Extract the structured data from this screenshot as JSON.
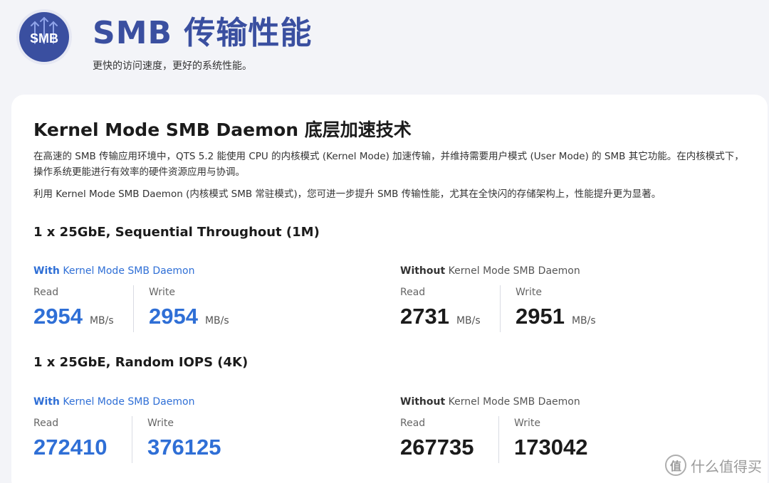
{
  "header": {
    "logo_text": "SMB",
    "title": "SMB 传输性能",
    "subtitle": "更快的访问速度，更好的系统性能。"
  },
  "card": {
    "section_title": "Kernel Mode SMB Daemon 底层加速技术",
    "para1": "在高速的 SMB 传输应用环境中，QTS 5.2 能使用 CPU 的内核模式 (Kernel Mode) 加速传输，并维持需要用户模式 (User Mode) 的 SMB 其它功能。在内核模式下，操作系统更能进行有效率的硬件资源应用与协调。",
    "para2": "利用 Kernel Mode SMB Daemon (内核模式 SMB 常驻模式)，您可进一步提升 SMB 传输性能，尤其在全快闪的存储架构上，性能提升更为显著。",
    "benchmarks": [
      {
        "title": "1 x 25GbE, Sequential Throughout (1M)",
        "with": {
          "prefix": "With",
          "suffix": " Kernel Mode SMB Daemon",
          "read_label": "Read",
          "read_value": "2954",
          "read_unit": "MB/s",
          "write_label": "Write",
          "write_value": "2954",
          "write_unit": "MB/s"
        },
        "without": {
          "prefix": "Without",
          "suffix": " Kernel Mode SMB Daemon",
          "read_label": "Read",
          "read_value": "2731",
          "read_unit": "MB/s",
          "write_label": "Write",
          "write_value": "2951",
          "write_unit": "MB/s"
        }
      },
      {
        "title": "1 x 25GbE, Random IOPS (4K)",
        "with": {
          "prefix": "With",
          "suffix": " Kernel Mode SMB Daemon",
          "read_label": "Read",
          "read_value": "272410",
          "write_label": "Write",
          "write_value": "376125"
        },
        "without": {
          "prefix": "Without",
          "suffix": " Kernel Mode SMB Daemon",
          "read_label": "Read",
          "read_value": "267735",
          "write_label": "Write",
          "write_value": "173042"
        }
      }
    ]
  },
  "watermark": {
    "icon_glyph": "值",
    "text": "什么值得买"
  },
  "colors": {
    "accent": "#2f6fd6",
    "brand": "#3a4fa0"
  }
}
